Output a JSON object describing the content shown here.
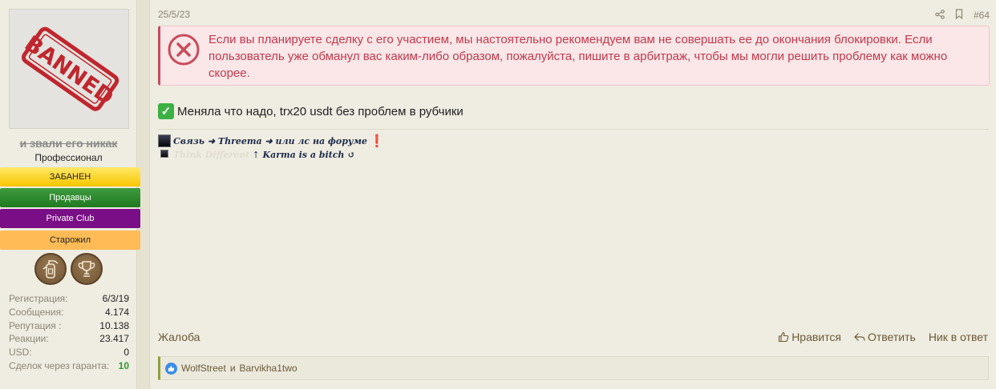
{
  "user": {
    "avatar_stamp": "BANNED",
    "username": "и звали его никак",
    "title": "Профессионал",
    "banners": {
      "banned": "ЗАБАНЕН",
      "sellers": "Продавцы",
      "private": "Private Club",
      "oldtimer": "Старожил"
    },
    "trophy_icons": [
      "extinguisher-icon",
      "cup-icon"
    ],
    "stats": [
      {
        "label": "Регистрация:",
        "value": "6/3/19"
      },
      {
        "label": "Сообщения:",
        "value": "4.174"
      },
      {
        "label": "Репутация :",
        "value": "10.138"
      },
      {
        "label": "Реакции:",
        "value": "23.417"
      },
      {
        "label": "USD:",
        "value": "0"
      },
      {
        "label": "Сделок через гаранта:",
        "value": "10"
      }
    ]
  },
  "post": {
    "date": "25/5/23",
    "number": "#64",
    "warning": "Если вы планируете сделку с его участием, мы настоятельно рекомендуем вам не совершать ее до окончания блокировки. Если пользователь уже обманул вас каким-либо образом, пожалуйста, пишите в арбитраж, чтобы мы могли решить проблему как можно скорее.",
    "message": "Меняла что надо, trx20 usdt без проблем в рубчики",
    "signature": {
      "line1": "Связь ➜ Threema ➜ или лс на форуме",
      "line2_hidden": "Think Different",
      "line2": "⇡ Karma is a bitch ↺"
    },
    "report": "Жалоба",
    "actions": {
      "like": "Нравится",
      "reply": "Ответить",
      "nick": "Ник в ответ"
    },
    "reactions": {
      "user1": "WolfStreet",
      "conj": "и",
      "user2": "Barvikha1two"
    }
  },
  "colors": {
    "accent": "#6b5a36",
    "warning": "#c13a4c",
    "banned": "#f9c600",
    "sellers": "#1f7a1f",
    "private": "#7a0e86",
    "oldtimer": "#ffbb55"
  }
}
